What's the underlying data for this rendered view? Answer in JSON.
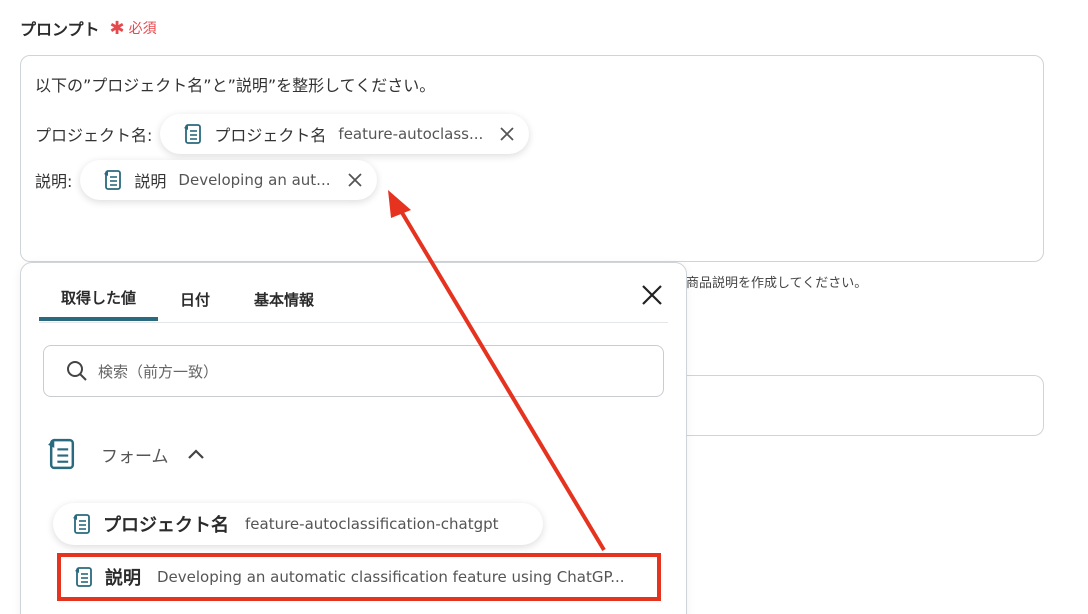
{
  "field": {
    "label": "プロンプト",
    "required_mark": "✱",
    "required_text": "必須"
  },
  "prompt": {
    "line1": "以下の”プロジェクト名”と”説明”を整形してください。",
    "rows": [
      {
        "label": "プロジェクト名:",
        "chip_name": "プロジェクト名",
        "chip_value": "feature-autoclass..."
      },
      {
        "label": "説明:",
        "chip_name": "説明",
        "chip_value": "Developing an aut..."
      }
    ]
  },
  "helper_text": "商品説明を作成してください。",
  "panel": {
    "tabs": [
      {
        "label": "取得した値",
        "active": true
      },
      {
        "label": "日付",
        "active": false
      },
      {
        "label": "基本情報",
        "active": false
      }
    ],
    "search_placeholder": "検索（前方一致）",
    "section_title": "フォーム",
    "items": [
      {
        "name": "プロジェクト名",
        "value": "feature-autoclassification-chatgpt"
      },
      {
        "name": "説明",
        "value": "Developing an automatic classification feature using ChatGP..."
      }
    ]
  },
  "colors": {
    "accent": "#2a6a7e",
    "required": "#e5484d",
    "highlight": "#e53320"
  },
  "icons": [
    "document-icon",
    "close-icon",
    "search-icon",
    "chevron-up-icon"
  ]
}
